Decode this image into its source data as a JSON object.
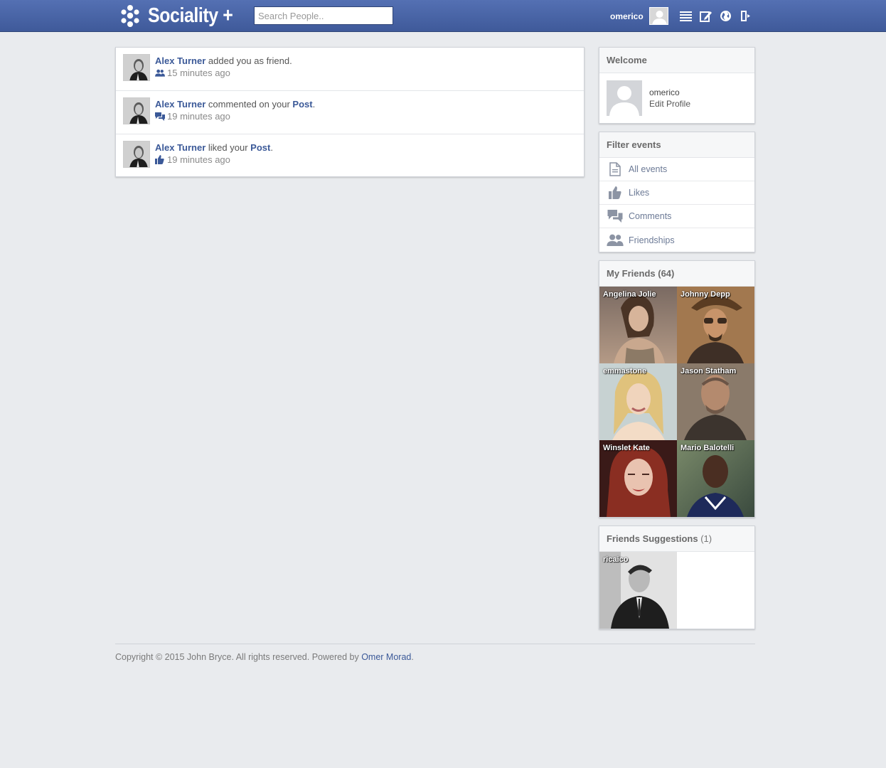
{
  "header": {
    "logo_text": "Sociality +",
    "search_placeholder": "Search People..",
    "username": "omerico"
  },
  "notifications": [
    {
      "actor": "Alex Turner",
      "text": " added you as friend.",
      "object": "",
      "suffix": "",
      "time": "15 minutes ago",
      "icon": "friends-icon"
    },
    {
      "actor": "Alex Turner",
      "text": " commented on your ",
      "object": "Post",
      "suffix": ".",
      "time": "19 minutes ago",
      "icon": "comments-icon"
    },
    {
      "actor": "Alex Turner",
      "text": " liked your ",
      "object": "Post",
      "suffix": ".",
      "time": "19 minutes ago",
      "icon": "like-icon"
    }
  ],
  "welcome": {
    "title": "Welcome",
    "name": "omerico",
    "edit_label": "Edit Profile"
  },
  "filter": {
    "title": "Filter events",
    "items": [
      {
        "label": "All events",
        "icon": "document-icon"
      },
      {
        "label": "Likes",
        "icon": "like-icon"
      },
      {
        "label": "Comments",
        "icon": "comments-icon"
      },
      {
        "label": "Friendships",
        "icon": "friends-icon"
      }
    ]
  },
  "friends": {
    "title": "My Friends",
    "count": "(64)",
    "items": [
      {
        "name": "Angelina Jolie",
        "color": "#a48a76"
      },
      {
        "name": "Johnny Depp",
        "color": "#7b5a40"
      },
      {
        "name": "emmastone",
        "color": "#d9c6a2"
      },
      {
        "name": "Jason Statham",
        "color": "#6f5b4a"
      },
      {
        "name": "Winslet Kate",
        "color": "#8a3a30"
      },
      {
        "name": "Mario Balotelli",
        "color": "#4d5c4c"
      }
    ]
  },
  "suggestions": {
    "title": "Friends Suggestions",
    "count": "(1)",
    "items": [
      {
        "name": "ricaico",
        "color": "#6a6a6a"
      }
    ]
  },
  "footer": {
    "text": "Copyright © 2015 John Bryce. All rights reserved. Powered by ",
    "link": "Omer Morad",
    "suffix": "."
  },
  "colors": {
    "brand": "#3b5998",
    "header_bg": "#4a66a8",
    "background": "#e9ebee"
  }
}
